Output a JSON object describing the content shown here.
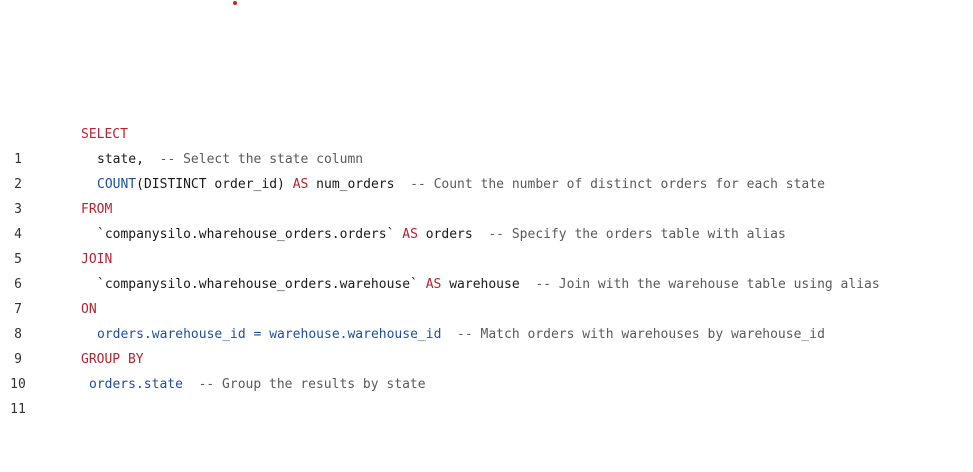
{
  "editor": {
    "lines": [
      {
        "number": "1",
        "tokens": [
          {
            "type": "kw",
            "text": "SELECT"
          }
        ]
      },
      {
        "number": "2",
        "tokens": [
          {
            "type": "id",
            "text": "state, "
          },
          {
            "type": "cm",
            "text": " -- Select the state column"
          }
        ]
      },
      {
        "number": "3",
        "tokens": [
          {
            "type": "fn",
            "text": "COUNT"
          },
          {
            "type": "id",
            "text": "(DISTINCT order_id) "
          },
          {
            "type": "kw",
            "text": "AS"
          },
          {
            "type": "id",
            "text": " num_orders  "
          },
          {
            "type": "cm",
            "text": "-- Count the number of distinct orders for each state"
          }
        ]
      },
      {
        "number": "4",
        "tokens": [
          {
            "type": "kw",
            "text": "FROM"
          }
        ]
      },
      {
        "number": "5",
        "tokens": [
          {
            "type": "id",
            "text": "`companysilo.wharehouse_orders.orders` "
          },
          {
            "type": "kw",
            "text": "AS"
          },
          {
            "type": "id",
            "text": " orders  "
          },
          {
            "type": "cm",
            "text": "-- Specify the orders table with alias"
          }
        ]
      },
      {
        "number": "6",
        "tokens": [
          {
            "type": "kw",
            "text": "JOIN"
          }
        ]
      },
      {
        "number": "7",
        "tokens": [
          {
            "type": "id",
            "text": "`companysilo.wharehouse_orders.warehouse` "
          },
          {
            "type": "kw",
            "text": "AS"
          },
          {
            "type": "id",
            "text": " warehouse  "
          },
          {
            "type": "cm",
            "text": "-- Join with the warehouse table using alias"
          }
        ]
      },
      {
        "number": "8",
        "tokens": [
          {
            "type": "kw",
            "text": "ON"
          }
        ]
      },
      {
        "number": "9",
        "tokens": [
          {
            "type": "ref",
            "text": "orders.warehouse_id"
          },
          {
            "type": "op",
            "text": " = "
          },
          {
            "type": "ref",
            "text": "warehouse.warehouse_id"
          },
          {
            "type": "cm",
            "text": "  -- Match orders with warehouses by warehouse_id"
          }
        ]
      },
      {
        "number": "10",
        "tokens": [
          {
            "type": "kw",
            "text": "GROUP BY"
          }
        ]
      },
      {
        "number": "11",
        "tokens": [
          {
            "type": "ref",
            "text": "orders.state"
          },
          {
            "type": "cm",
            "text": "  -- Group the results by state"
          }
        ]
      }
    ]
  }
}
